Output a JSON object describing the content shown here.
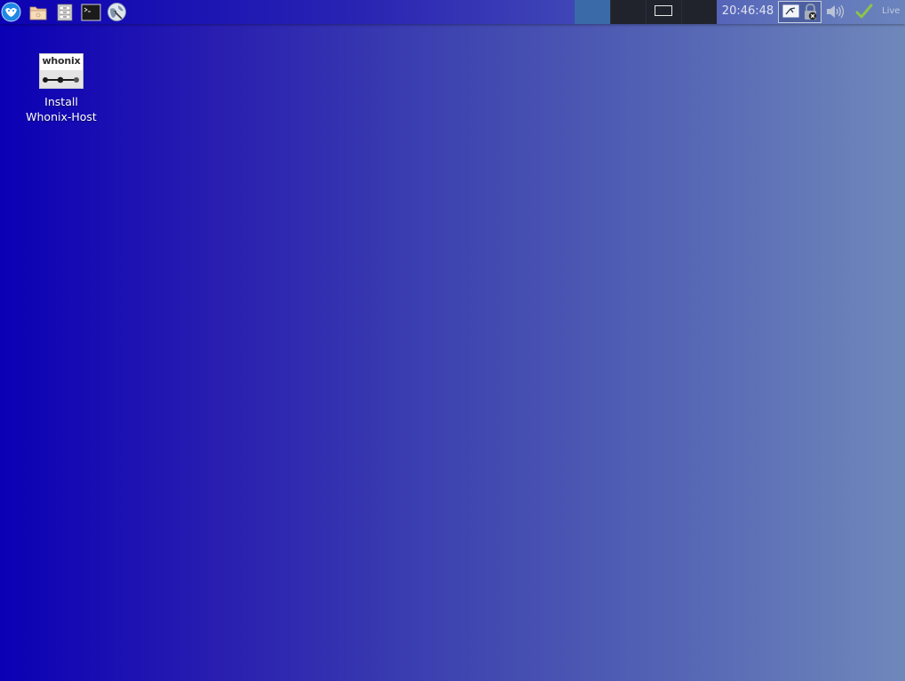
{
  "panel": {
    "launchers": [
      {
        "name": "app-menu-icon"
      },
      {
        "name": "file-manager-icon"
      },
      {
        "name": "file-cabinet-icon"
      },
      {
        "name": "terminal-icon"
      },
      {
        "name": "web-browser-icon"
      }
    ],
    "pager": {
      "workspaces": [
        {
          "state": "active"
        },
        {
          "state": "inactive"
        },
        {
          "state": "inactive",
          "has_window": true
        },
        {
          "state": "inactive"
        }
      ]
    },
    "clock": {
      "time": "20:46:48"
    },
    "tray": {
      "icons": [
        "network-disconnected-icon",
        "lock-disabled-icon",
        "volume-icon",
        "check-mark-icon"
      ]
    },
    "live_label": "Live"
  },
  "desktop": {
    "icons": [
      {
        "logo_text": "whonix",
        "label_line1": "Install",
        "label_line2": "Whonix-Host"
      }
    ]
  },
  "colors": {
    "desktop_left": "#0b00b4",
    "desktop_right": "#6f88bb",
    "active_workspace": "#3a6aa8",
    "check_mark": "#8bc34a"
  }
}
